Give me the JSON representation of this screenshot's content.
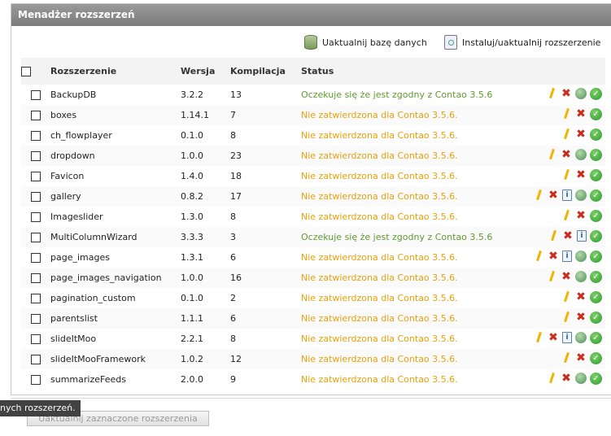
{
  "panel": {
    "title": "Menadżer rozszerzeń"
  },
  "toolbar": {
    "update_db_label": "Uaktualnij bazę danych",
    "install_label": "Instaluj/uaktualnij rozszerzenie"
  },
  "table": {
    "headers": {
      "name": "Rozszerzenie",
      "version": "Wersja",
      "build": "Kompilacja",
      "status": "Status"
    },
    "rows": [
      {
        "name": "BackupDB",
        "version": "3.2.2",
        "build": "13",
        "status": "Oczekuje się że jest zgodny z Contao 3.5.6",
        "status_type": "ok",
        "actions": [
          "edit",
          "delete",
          "update",
          "ok"
        ]
      },
      {
        "name": "boxes",
        "version": "1.14.1",
        "build": "7",
        "status": "Nie zatwierdzona dla Contao 3.5.6.",
        "status_type": "warn",
        "actions": [
          "edit",
          "delete",
          "ok"
        ]
      },
      {
        "name": "ch_flowplayer",
        "version": "0.1.0",
        "build": "8",
        "status": "Nie zatwierdzona dla Contao 3.5.6.",
        "status_type": "warn",
        "actions": [
          "edit",
          "delete",
          "ok"
        ]
      },
      {
        "name": "dropdown",
        "version": "1.0.0",
        "build": "23",
        "status": "Nie zatwierdzona dla Contao 3.5.6.",
        "status_type": "warn",
        "actions": [
          "edit",
          "delete",
          "update",
          "ok"
        ]
      },
      {
        "name": "Favicon",
        "version": "1.4.0",
        "build": "18",
        "status": "Nie zatwierdzona dla Contao 3.5.6.",
        "status_type": "warn",
        "actions": [
          "edit",
          "delete",
          "ok"
        ]
      },
      {
        "name": "gallery",
        "version": "0.8.2",
        "build": "17",
        "status": "Nie zatwierdzona dla Contao 3.5.6.",
        "status_type": "warn",
        "actions": [
          "edit",
          "delete",
          "info",
          "update",
          "ok"
        ]
      },
      {
        "name": "Imageslider",
        "version": "1.3.0",
        "build": "8",
        "status": "Nie zatwierdzona dla Contao 3.5.6.",
        "status_type": "warn",
        "actions": [
          "edit",
          "delete",
          "ok"
        ]
      },
      {
        "name": "MultiColumnWizard",
        "version": "3.3.3",
        "build": "3",
        "status": "Oczekuje się że jest zgodny z Contao 3.5.6",
        "status_type": "ok",
        "actions": [
          "edit",
          "delete",
          "info",
          "ok"
        ]
      },
      {
        "name": "page_images",
        "version": "1.3.1",
        "build": "6",
        "status": "Nie zatwierdzona dla Contao 3.5.6.",
        "status_type": "warn",
        "actions": [
          "edit",
          "delete",
          "info",
          "update",
          "ok"
        ]
      },
      {
        "name": "page_images_navigation",
        "version": "1.0.0",
        "build": "16",
        "status": "Nie zatwierdzona dla Contao 3.5.6.",
        "status_type": "warn",
        "actions": [
          "edit",
          "delete",
          "update",
          "ok"
        ]
      },
      {
        "name": "pagination_custom",
        "version": "0.1.0",
        "build": "2",
        "status": "Nie zatwierdzona dla Contao 3.5.6.",
        "status_type": "warn",
        "actions": [
          "edit",
          "delete",
          "ok"
        ]
      },
      {
        "name": "parentslist",
        "version": "1.1.1",
        "build": "6",
        "status": "Nie zatwierdzona dla Contao 3.5.6.",
        "status_type": "warn",
        "actions": [
          "edit",
          "delete",
          "ok"
        ]
      },
      {
        "name": "slideItMoo",
        "version": "2.2.1",
        "build": "8",
        "status": "Nie zatwierdzona dla Contao 3.5.6.",
        "status_type": "warn",
        "actions": [
          "edit",
          "delete",
          "info",
          "update",
          "ok"
        ]
      },
      {
        "name": "slideItMooFramework",
        "version": "1.0.2",
        "build": "12",
        "status": "Nie zatwierdzona dla Contao 3.5.6.",
        "status_type": "warn",
        "actions": [
          "edit",
          "delete",
          "ok"
        ]
      },
      {
        "name": "summarizeFeeds",
        "version": "2.0.0",
        "build": "9",
        "status": "Nie zatwierdzona dla Contao 3.5.6.",
        "status_type": "warn",
        "actions": [
          "edit",
          "delete",
          "update",
          "ok"
        ]
      }
    ]
  },
  "colors": {
    "status_ok": "#5f9a2f",
    "status_warn": "#e8a10a",
    "header_bar": "#8a8a8a"
  },
  "tooltip": {
    "text": "nych rozszerzeń."
  },
  "footer": {
    "submit_label": "Uaktualnij zaznaczone rozszerzenia"
  }
}
